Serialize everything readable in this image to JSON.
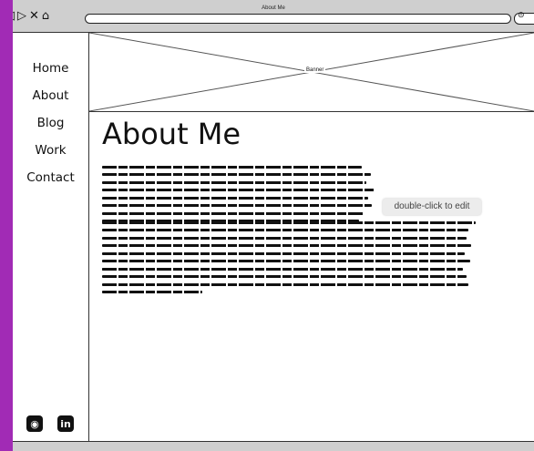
{
  "window": {
    "title": "About Me"
  },
  "nav_icons": {
    "back": "◁",
    "forward": "▷",
    "close": "✕",
    "home": "⌂"
  },
  "search_icon": "⊝",
  "sidebar": {
    "items": [
      {
        "label": "Home"
      },
      {
        "label": "About"
      },
      {
        "label": "Blog"
      },
      {
        "label": "Work"
      },
      {
        "label": "Contact"
      }
    ],
    "social": [
      {
        "icon": "github-icon",
        "glyph": "◉"
      },
      {
        "icon": "linkedin-icon",
        "glyph": "in"
      }
    ]
  },
  "banner": {
    "label": "Banner"
  },
  "main": {
    "title": "About Me",
    "tooltip": "double-click to edit"
  }
}
